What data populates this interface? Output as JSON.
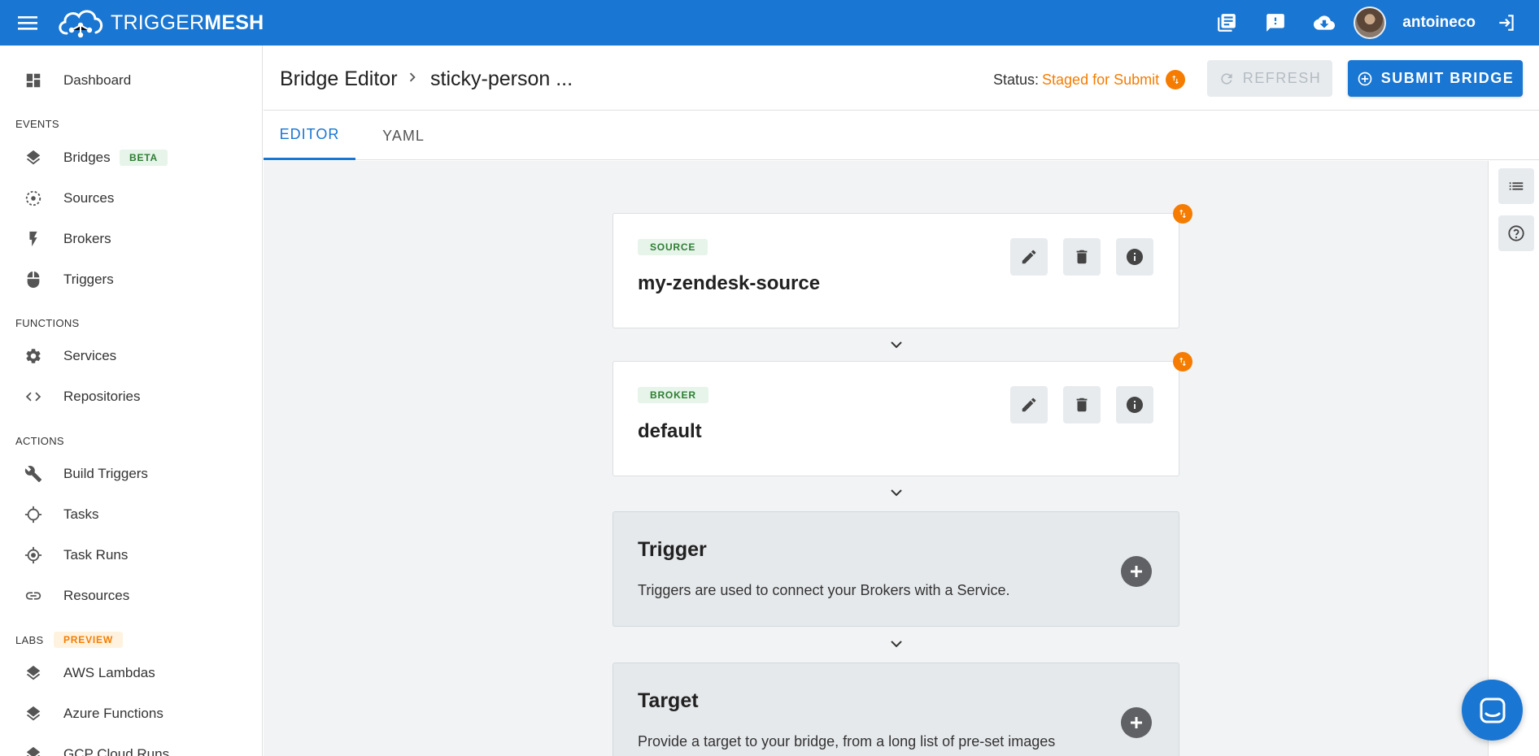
{
  "app": {
    "logo_text_light": "TRIGGER",
    "logo_text_bold": "MESH",
    "username": "antoineco",
    "brand_color": "#1976d2"
  },
  "topbar_icons": [
    "library-books-icon",
    "feedback-icon",
    "cloud-download-icon",
    "avatar",
    "logout-icon"
  ],
  "sidebar": {
    "items_top": [
      {
        "label": "Dashboard",
        "icon": "dashboard-icon"
      }
    ],
    "sections": [
      {
        "title": "EVENTS",
        "items": [
          {
            "label": "Bridges",
            "icon": "layers-icon",
            "chip": "BETA"
          },
          {
            "label": "Sources",
            "icon": "source-icon"
          },
          {
            "label": "Brokers",
            "icon": "bolt-icon"
          },
          {
            "label": "Triggers",
            "icon": "mouse-icon"
          }
        ]
      },
      {
        "title": "FUNCTIONS",
        "items": [
          {
            "label": "Services",
            "icon": "gear-icon"
          },
          {
            "label": "Repositories",
            "icon": "code-icon"
          }
        ]
      },
      {
        "title": "ACTIONS",
        "items": [
          {
            "label": "Build Triggers",
            "icon": "wrench-icon"
          },
          {
            "label": "Tasks",
            "icon": "crosshair-icon"
          },
          {
            "label": "Task Runs",
            "icon": "target-icon"
          },
          {
            "label": "Resources",
            "icon": "link-icon"
          }
        ]
      },
      {
        "title": "LABS",
        "chip": "PREVIEW",
        "items": [
          {
            "label": "AWS Lambdas",
            "icon": "layers-icon"
          },
          {
            "label": "Azure Functions",
            "icon": "layers-icon"
          },
          {
            "label": "GCP Cloud Runs",
            "icon": "layers-icon"
          }
        ]
      }
    ]
  },
  "header": {
    "breadcrumb_root": "Bridge Editor",
    "breadcrumb_current": "sticky-person ...",
    "status_label": "Status:",
    "status_value": "Staged for Submit",
    "status_color": "#f57c00",
    "refresh_label": "REFRESH",
    "submit_label": "SUBMIT BRIDGE"
  },
  "tabs": [
    {
      "label": "EDITOR",
      "active": true
    },
    {
      "label": "YAML",
      "active": false
    }
  ],
  "bridge": {
    "components": [
      {
        "tag": "SOURCE",
        "name": "my-zendesk-source"
      },
      {
        "tag": "BROKER",
        "name": "default"
      }
    ],
    "slots": [
      {
        "title": "Trigger",
        "description": "Triggers are used to connect your Brokers with a Service."
      },
      {
        "title": "Target",
        "description": "Provide a target to your bridge, from a long list of pre-set images"
      }
    ]
  },
  "rightbar_icons": [
    "list-icon",
    "help-icon"
  ]
}
